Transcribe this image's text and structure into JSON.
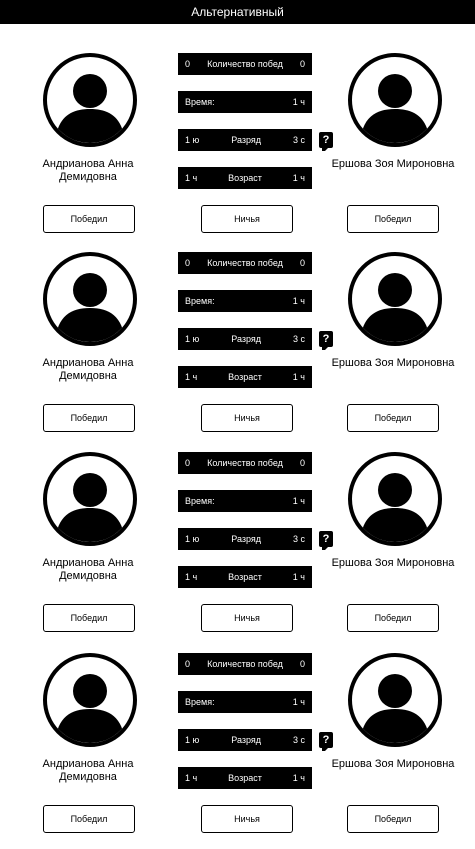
{
  "header": {
    "title": "Альтернативный"
  },
  "icons": {
    "avatar": "person-silhouette-icon",
    "help": "question-mark-icon"
  },
  "matches": [
    {
      "left_player": "Андрианова Анна Демидовна",
      "right_player": "Ершова Зоя Мироновна",
      "wins": {
        "left": "0",
        "label": "Количество побед",
        "right": "0"
      },
      "time": {
        "label": "Время:",
        "value": "1 ч"
      },
      "rank": {
        "left": "1 ю",
        "label": "Разряд",
        "right": "3 с"
      },
      "age": {
        "left": "1 ч",
        "label": "Возраст",
        "right": "1 ч"
      },
      "help": "?",
      "buttons": {
        "left": "Победил",
        "draw": "Ничья",
        "right": "Победил"
      }
    },
    {
      "left_player": "Андрианова Анна Демидовна",
      "right_player": "Ершова Зоя Мироновна",
      "wins": {
        "left": "0",
        "label": "Количество побед",
        "right": "0"
      },
      "time": {
        "label": "Время:",
        "value": "1 ч"
      },
      "rank": {
        "left": "1 ю",
        "label": "Разряд",
        "right": "3 с"
      },
      "age": {
        "left": "1 ч",
        "label": "Возраст",
        "right": "1 ч"
      },
      "help": "?",
      "buttons": {
        "left": "Победил",
        "draw": "Ничья",
        "right": "Победил"
      }
    },
    {
      "left_player": "Андрианова Анна Демидовна",
      "right_player": "Ершова Зоя Мироновна",
      "wins": {
        "left": "0",
        "label": "Количество побед",
        "right": "0"
      },
      "time": {
        "label": "Время:",
        "value": "1 ч"
      },
      "rank": {
        "left": "1 ю",
        "label": "Разряд",
        "right": "3 с"
      },
      "age": {
        "left": "1 ч",
        "label": "Возраст",
        "right": "1 ч"
      },
      "help": "?",
      "buttons": {
        "left": "Победил",
        "draw": "Ничья",
        "right": "Победил"
      }
    },
    {
      "left_player": "Андрианова Анна Демидовна",
      "right_player": "Ершова Зоя Мироновна",
      "wins": {
        "left": "0",
        "label": "Количество побед",
        "right": "0"
      },
      "time": {
        "label": "Время:",
        "value": "1 ч"
      },
      "rank": {
        "left": "1 ю",
        "label": "Разряд",
        "right": "3 с"
      },
      "age": {
        "left": "1 ч",
        "label": "Возраст",
        "right": "1 ч"
      },
      "help": "?",
      "buttons": {
        "left": "Победил",
        "draw": "Ничья",
        "right": "Победил"
      }
    }
  ]
}
